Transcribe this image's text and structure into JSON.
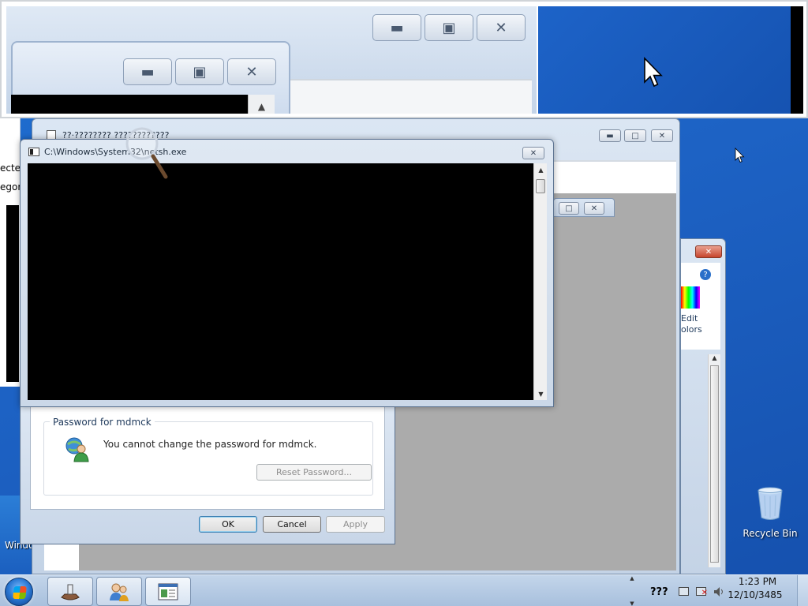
{
  "console": {
    "title": "C:\\Windows\\System32\\netsh.exe"
  },
  "background_window": {
    "title": "??·????????  ????????????"
  },
  "side_window": {
    "edit_colors_line1": "Edit",
    "edit_colors_line2": "olors"
  },
  "left_edge": {
    "text1": "ecte",
    "text2": "egor",
    "text3": "Windo"
  },
  "password_dialog": {
    "group_label": "Password for mdmck",
    "message": "You cannot change the password for mdmck.",
    "reset_button": "Reset Password...",
    "ok_button": "OK",
    "cancel_button": "Cancel",
    "apply_button": "Apply"
  },
  "desktop": {
    "recycle_bin_label": "Recycle Bin"
  },
  "taskbar": {
    "language": "???",
    "time": "1:23 PM",
    "date": "12/10/3485"
  },
  "icons": {
    "start": "windows-start-orb",
    "task1": "network-share-icon",
    "task2": "user-accounts-icon",
    "task3": "control-panel-icon"
  },
  "colors": {
    "desktop": "#1d62c4",
    "console_bg": "#000000",
    "taskbar": "#b6cbe3"
  }
}
